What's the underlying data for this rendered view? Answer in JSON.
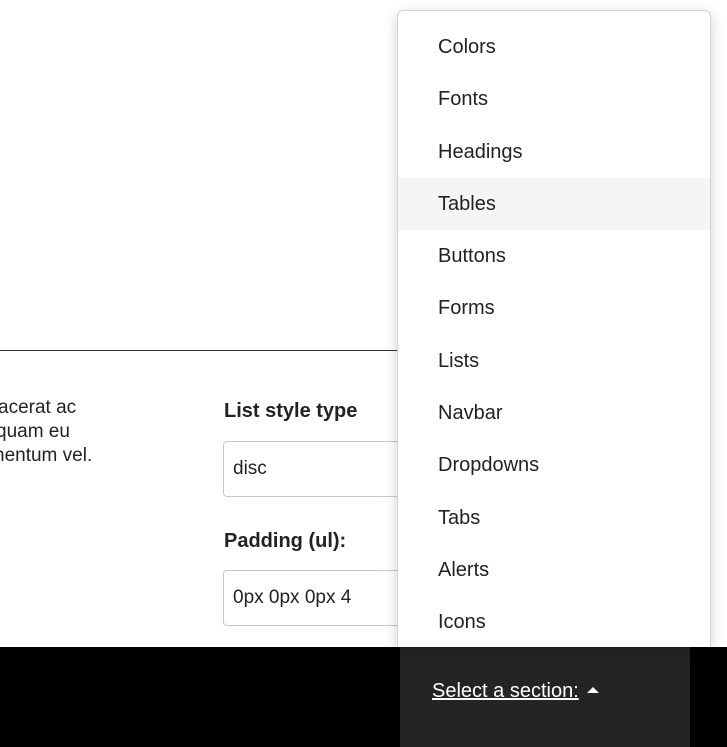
{
  "paragraph": {
    "lines": [
      "acerat ac",
      "quam eu",
      "nentum vel."
    ]
  },
  "form": {
    "list_style_label": "List style type",
    "list_style_value": "disc",
    "padding_label": "Padding (ul):",
    "padding_value": "0px 0px 0px 4"
  },
  "section_selector": {
    "label": "Select a section:",
    "icon": "caret-up-icon"
  },
  "dropdown": {
    "items": [
      {
        "label": "Colors"
      },
      {
        "label": "Fonts"
      },
      {
        "label": "Headings"
      },
      {
        "label": "Tables",
        "active": true
      },
      {
        "label": "Buttons"
      },
      {
        "label": "Forms"
      },
      {
        "label": "Lists"
      },
      {
        "label": "Navbar"
      },
      {
        "label": "Dropdowns"
      },
      {
        "label": "Tabs"
      },
      {
        "label": "Alerts"
      },
      {
        "label": "Icons"
      }
    ]
  },
  "colors": {
    "bottom_bar": "#000000",
    "toggle_bg": "#242424",
    "hover_bg": "#f5f5f5"
  }
}
